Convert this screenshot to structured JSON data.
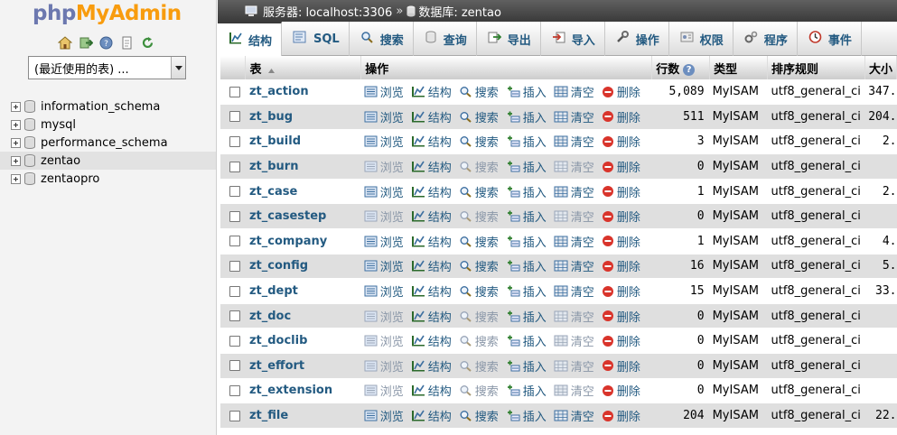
{
  "logo": {
    "php": "php",
    "myadmin": "MyAdmin"
  },
  "nav": {
    "icons": [
      "home-icon",
      "exit-icon",
      "query-icon",
      "docs-icon",
      "reload-icon"
    ],
    "recent_select": "(最近使用的表) ...",
    "databases": [
      {
        "name": "information_schema",
        "selected": false
      },
      {
        "name": "mysql",
        "selected": false
      },
      {
        "name": "performance_schema",
        "selected": false
      },
      {
        "name": "zentao",
        "selected": true
      },
      {
        "name": "zentaopro",
        "selected": false
      }
    ]
  },
  "breadcrumb": {
    "server_label": "服务器: localhost:3306",
    "separator": "»",
    "db_label": "数据库: zentao"
  },
  "tabs": [
    {
      "label": "结构",
      "icon": "structure-icon",
      "active": true
    },
    {
      "label": "SQL",
      "icon": "sql-icon",
      "active": false
    },
    {
      "label": "搜索",
      "icon": "search-icon",
      "active": false
    },
    {
      "label": "查询",
      "icon": "query-icon",
      "active": false
    },
    {
      "label": "导出",
      "icon": "export-icon",
      "active": false
    },
    {
      "label": "导入",
      "icon": "import-icon",
      "active": false
    },
    {
      "label": "操作",
      "icon": "operations-icon",
      "active": false
    },
    {
      "label": "权限",
      "icon": "privileges-icon",
      "active": false
    },
    {
      "label": "程序",
      "icon": "routines-icon",
      "active": false
    },
    {
      "label": "事件",
      "icon": "events-icon",
      "active": false
    }
  ],
  "table": {
    "headers": {
      "table": "表",
      "action": "操作",
      "rows": "行数",
      "type": "类型",
      "collation": "排序规则",
      "size": "大小"
    },
    "ops": {
      "browse": "浏览",
      "structure": "结构",
      "search": "搜索",
      "insert": "插入",
      "empty": "清空",
      "drop": "删除"
    },
    "rows": [
      {
        "name": "zt_action",
        "rows": "5,089",
        "type": "MyISAM",
        "collation": "utf8_general_ci",
        "size": "347.",
        "empty": false
      },
      {
        "name": "zt_bug",
        "rows": "511",
        "type": "MyISAM",
        "collation": "utf8_general_ci",
        "size": "204.",
        "empty": false
      },
      {
        "name": "zt_build",
        "rows": "3",
        "type": "MyISAM",
        "collation": "utf8_general_ci",
        "size": "2.",
        "empty": false
      },
      {
        "name": "zt_burn",
        "rows": "0",
        "type": "MyISAM",
        "collation": "utf8_general_ci",
        "size": "",
        "empty": true
      },
      {
        "name": "zt_case",
        "rows": "1",
        "type": "MyISAM",
        "collation": "utf8_general_ci",
        "size": "2.",
        "empty": false
      },
      {
        "name": "zt_casestep",
        "rows": "0",
        "type": "MyISAM",
        "collation": "utf8_general_ci",
        "size": "",
        "empty": true
      },
      {
        "name": "zt_company",
        "rows": "1",
        "type": "MyISAM",
        "collation": "utf8_general_ci",
        "size": "4.",
        "empty": false
      },
      {
        "name": "zt_config",
        "rows": "16",
        "type": "MyISAM",
        "collation": "utf8_general_ci",
        "size": "5.",
        "empty": false
      },
      {
        "name": "zt_dept",
        "rows": "15",
        "type": "MyISAM",
        "collation": "utf8_general_ci",
        "size": "33.",
        "empty": false
      },
      {
        "name": "zt_doc",
        "rows": "0",
        "type": "MyISAM",
        "collation": "utf8_general_ci",
        "size": "",
        "empty": true
      },
      {
        "name": "zt_doclib",
        "rows": "0",
        "type": "MyISAM",
        "collation": "utf8_general_ci",
        "size": "",
        "empty": true
      },
      {
        "name": "zt_effort",
        "rows": "0",
        "type": "MyISAM",
        "collation": "utf8_general_ci",
        "size": "",
        "empty": true
      },
      {
        "name": "zt_extension",
        "rows": "0",
        "type": "MyISAM",
        "collation": "utf8_general_ci",
        "size": "",
        "empty": true
      },
      {
        "name": "zt_file",
        "rows": "204",
        "type": "MyISAM",
        "collation": "utf8_general_ci",
        "size": "22.",
        "empty": false
      }
    ]
  },
  "colors": {
    "link": "#235a81",
    "dim_link": "#8a97a8",
    "logo_php": "#6c78af",
    "logo_myadmin": "#f89c0e",
    "row_alt": "#dfdfdf",
    "drop_red": "#d9342b"
  }
}
